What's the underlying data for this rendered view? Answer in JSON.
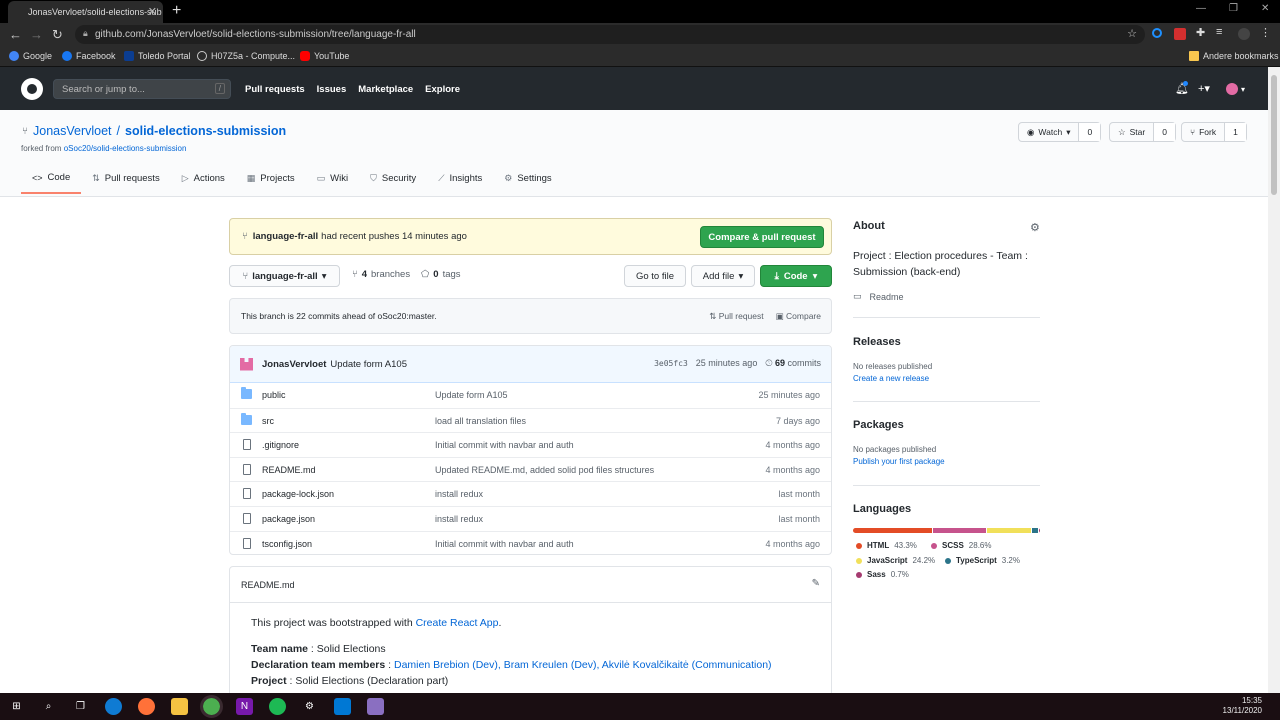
{
  "browser": {
    "tab_title": "JonasVervloet/solid-elections-sub",
    "url": "github.com/JonasVervloet/solid-elections-submission/tree/language-fr-all",
    "bookmarks": [
      "Google",
      "Facebook",
      "Toledo Portal",
      "H07Z5a - Compute...",
      "YouTube"
    ],
    "other_bookmarks": "Andere bookmarks"
  },
  "gh_header": {
    "search_placeholder": "Search or jump to...",
    "search_key": "/",
    "nav": [
      "Pull requests",
      "Issues",
      "Marketplace",
      "Explore"
    ]
  },
  "repo": {
    "owner": "JonasVervloet",
    "separator": "/",
    "name": "solid-elections-submission",
    "forked_prefix": "forked from",
    "forked_from": "oSoc20/solid-elections-submission",
    "watch_label": "Watch",
    "watch_count": "0",
    "star_label": "Star",
    "star_count": "0",
    "fork_label": "Fork",
    "fork_count": "1",
    "tabs": [
      "Code",
      "Pull requests",
      "Actions",
      "Projects",
      "Wiki",
      "Security",
      "Insights",
      "Settings"
    ]
  },
  "flash": {
    "branch": "language-fr-all",
    "text": "had recent pushes 14 minutes ago",
    "button": "Compare & pull request"
  },
  "branch_bar": {
    "branch": "language-fr-all",
    "branches_count": "4",
    "branches_label": "branches",
    "tags_count": "0",
    "tags_label": "tags",
    "go_to_file": "Go to file",
    "add_file": "Add file",
    "code": "Code"
  },
  "ahead": {
    "text": "This branch is 22 commits ahead of oSoc20:master.",
    "pull_request": "Pull request",
    "compare": "Compare"
  },
  "commit": {
    "author": "JonasVervloet",
    "message": "Update form A105",
    "sha": "3e05fc3",
    "age": "25 minutes ago",
    "commits_count": "69",
    "commits_label": "commits"
  },
  "files": [
    {
      "type": "folder",
      "name": "public",
      "message": "Update form A105",
      "age": "25 minutes ago"
    },
    {
      "type": "folder",
      "name": "src",
      "message": "load all translation files",
      "age": "7 days ago"
    },
    {
      "type": "file",
      "name": ".gitignore",
      "message": "Initial commit with navbar and auth",
      "age": "4 months ago"
    },
    {
      "type": "file",
      "name": "README.md",
      "message": "Updated README.md, added solid pod files structures",
      "age": "4 months ago"
    },
    {
      "type": "file",
      "name": "package-lock.json",
      "message": "install redux",
      "age": "last month"
    },
    {
      "type": "file",
      "name": "package.json",
      "message": "install redux",
      "age": "last month"
    },
    {
      "type": "file",
      "name": "tsconfig.json",
      "message": "Initial commit with navbar and auth",
      "age": "4 months ago"
    }
  ],
  "readme": {
    "filename": "README.md",
    "intro_prefix": "This project was bootstrapped with",
    "intro_link": "Create React App",
    "intro_suffix": ".",
    "team_name_label": "Team name",
    "team_name_value": ": Solid Elections",
    "members_label": "Declaration team members",
    "members_sep": ":",
    "members_value": "Damien Brebion (Dev), Bram Kreulen (Dev), Akvilė Kovalčikaitė (Communication)",
    "project_label": "Project",
    "project_value": ": Solid Elections (Declaration part)"
  },
  "about": {
    "title": "About",
    "description": "Project : Election procedures - Team : Submission (back-end)",
    "readme": "Readme"
  },
  "releases": {
    "title": "Releases",
    "none": "No releases published",
    "create": "Create a new release"
  },
  "packages": {
    "title": "Packages",
    "none": "No packages published",
    "publish": "Publish your first package"
  },
  "languages": {
    "title": "Languages",
    "items": [
      {
        "name": "HTML",
        "pct": "43.3%",
        "value": 43.3,
        "color": "#e34c26"
      },
      {
        "name": "SCSS",
        "pct": "28.6%",
        "value": 28.6,
        "color": "#c6538c"
      },
      {
        "name": "JavaScript",
        "pct": "24.2%",
        "value": 24.2,
        "color": "#f1e05a"
      },
      {
        "name": "TypeScript",
        "pct": "3.2%",
        "value": 3.2,
        "color": "#2b7489"
      },
      {
        "name": "Sass",
        "pct": "0.7%",
        "value": 0.7,
        "color": "#a53b70"
      }
    ]
  },
  "taskbar": {
    "time": "15:35",
    "date": "13/11/2020"
  }
}
